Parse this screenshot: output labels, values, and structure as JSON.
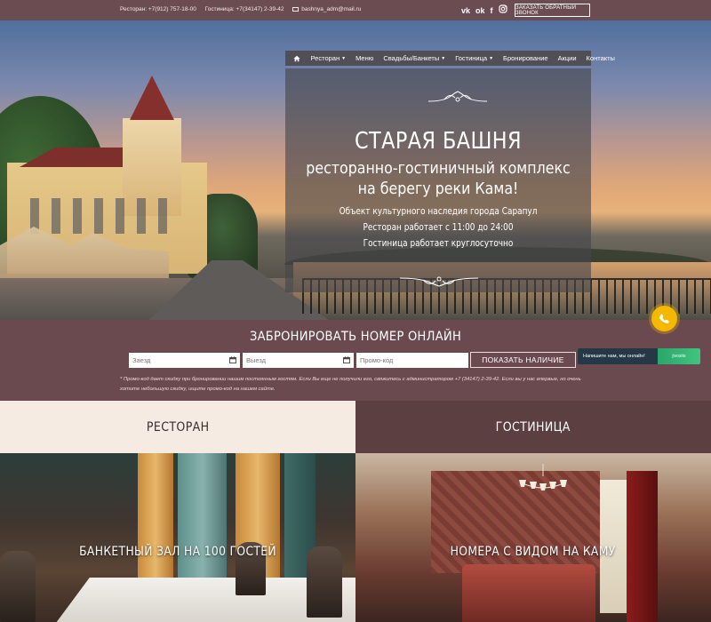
{
  "topbar": {
    "restaurant_phone": "Ресторан: +7(912) 757-18-00",
    "hotel_phone": "Гостиница: +7(34147) 2-39-42",
    "email": "bashnya_adm@mail.ru",
    "socials": [
      "vk-icon",
      "odnoklassniki-icon",
      "facebook-icon",
      "instagram-icon"
    ],
    "callback_label": "ЗАКАЗАТЬ ОБРАТНЫЙ ЗВОНОК"
  },
  "nav": {
    "items": [
      {
        "label": "Ресторан",
        "has_dropdown": true
      },
      {
        "label": "Меню",
        "has_dropdown": false
      },
      {
        "label": "Свадьбы/Банкеты",
        "has_dropdown": true
      },
      {
        "label": "Гостиница",
        "has_dropdown": true
      },
      {
        "label": "Бронирование",
        "has_dropdown": false
      },
      {
        "label": "Акции",
        "has_dropdown": false
      },
      {
        "label": "Контакты",
        "has_dropdown": false
      }
    ]
  },
  "hero": {
    "title": "СТАРАЯ БАШНЯ",
    "subtitle_line1": "ресторанно-гостиничный комплекс",
    "subtitle_line2": "на берегу реки Кама!",
    "heritage": "Объект культурного наследия города Сарапул",
    "restaurant_hours": "Ресторан работает с 11:00 до 24:00",
    "hotel_hours": "Гостиница работает круглосуточно"
  },
  "booking": {
    "title": "ЗАБРОНИРОВАТЬ НОМЕР ОНЛАЙН",
    "checkin_placeholder": "Заезд",
    "checkout_placeholder": "Выезд",
    "promo_placeholder": "Промо-код",
    "check_label": "ПОКАЗАТЬ НАЛИЧИЕ",
    "promo_note": "* Промо-код дает скидку при бронировании нашим постоянным гостям. Если Вы еще не получили его, свяжитесь с администратором +7 (34147) 2-39-42. Если вы у нас впервые, но очень хотите небольшую скидку, ищите промо-код на нашем сайте."
  },
  "chat": {
    "label": "Напишите нам, мы онлайн!",
    "brand": "jivosite"
  },
  "sections": {
    "restaurant_tab": "РЕСТОРАН",
    "hotel_tab": "ГОСТИНИЦА",
    "restaurant_caption": "БАНКЕТНЫЙ ЗАЛ НА 100 ГОСТЕЙ",
    "hotel_caption": "НОМЕРА С ВИДОМ НА КАМУ"
  },
  "colors": {
    "brand": "#6b4a4f",
    "nav_bg": "#4f4f55",
    "tab_light": "#f5ebe2",
    "tab_dark": "#5b3f41",
    "phone_fab": "#f5b800"
  }
}
